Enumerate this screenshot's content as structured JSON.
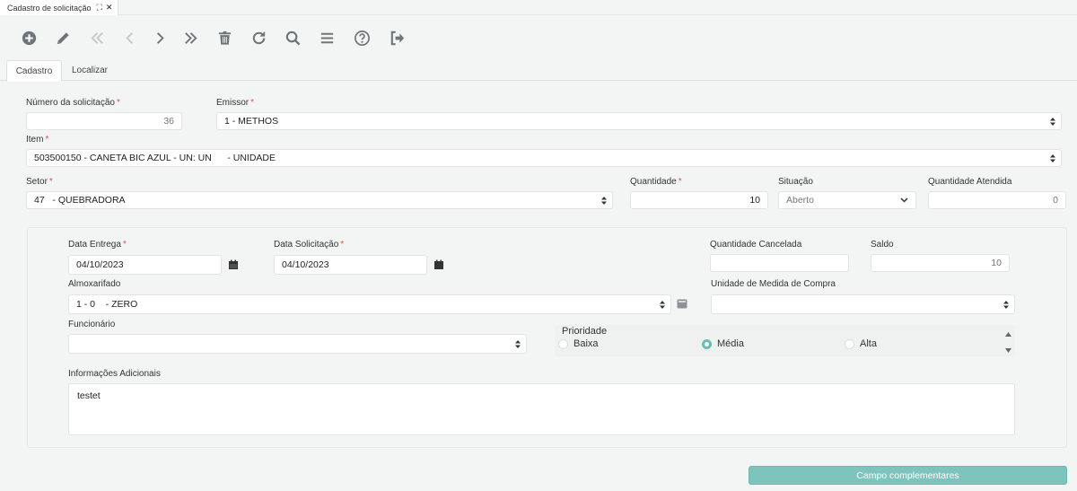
{
  "window_tab": {
    "title": "Cadastro de solicitação",
    "icons": [
      "expand-icon",
      "close-icon"
    ]
  },
  "toolbar": {
    "buttons": [
      {
        "name": "add-button",
        "icon": "plus-circle-icon"
      },
      {
        "name": "edit-button",
        "icon": "pencil-icon"
      },
      {
        "name": "first-button",
        "icon": "double-chevron-left-icon"
      },
      {
        "name": "prev-button",
        "icon": "chevron-left-icon"
      },
      {
        "name": "next-button",
        "icon": "chevron-right-icon"
      },
      {
        "name": "last-button",
        "icon": "double-chevron-right-icon"
      },
      {
        "name": "delete-button",
        "icon": "trash-icon"
      },
      {
        "name": "refresh-button",
        "icon": "refresh-icon"
      },
      {
        "name": "search-button",
        "icon": "search-icon"
      },
      {
        "name": "list-button",
        "icon": "list-icon"
      },
      {
        "name": "help-button",
        "icon": "help-circle-icon"
      },
      {
        "name": "exit-button",
        "icon": "sign-out-icon"
      }
    ]
  },
  "tabs": [
    {
      "label": "Cadastro",
      "active": true
    },
    {
      "label": "Localizar",
      "active": false
    }
  ],
  "form": {
    "numero": {
      "label": "Número da solicitação",
      "value": "36"
    },
    "emissor": {
      "label": "Emissor",
      "value": "1 - METHOS"
    },
    "item": {
      "label": "Item",
      "value": "503500150 - CANETA BIC AZUL - UN: UN      - UNIDADE"
    },
    "setor": {
      "label": "Setor",
      "value": "47   - QUEBRADORA"
    },
    "quantidade": {
      "label": "Quantidade",
      "value": "10"
    },
    "situacao": {
      "label": "Situação",
      "value": "Aberto"
    },
    "quantidade_atendida": {
      "label": "Quantidade Atendida",
      "value": "0"
    }
  },
  "panel": {
    "data_entrega": {
      "label": "Data Entrega",
      "value": "04/10/2023"
    },
    "data_solicitacao": {
      "label": "Data Solicitação",
      "value": "04/10/2023"
    },
    "quantidade_cancelada": {
      "label": "Quantidade Cancelada",
      "value": ""
    },
    "saldo": {
      "label": "Saldo",
      "value": "10"
    },
    "almoxarifado": {
      "label": "Almoxarifado",
      "value": "1 - 0    - ZERO"
    },
    "unidade_medida": {
      "label": "Unidade de Medida de Compra",
      "value": ""
    },
    "funcionario": {
      "label": "Funcionário",
      "value": ""
    },
    "prioridade": {
      "label": "Prioridade",
      "options": [
        {
          "label": "Baixa",
          "checked": false
        },
        {
          "label": "Média",
          "checked": true
        },
        {
          "label": "Alta",
          "checked": false
        }
      ]
    },
    "info": {
      "label": "Informações Adicionais",
      "value": "testet"
    }
  },
  "footer": {
    "button_label": "Campo complementares"
  },
  "colors": {
    "accent": "#66bfb3",
    "button": "#7cc4bc",
    "required": "#d9534f"
  }
}
